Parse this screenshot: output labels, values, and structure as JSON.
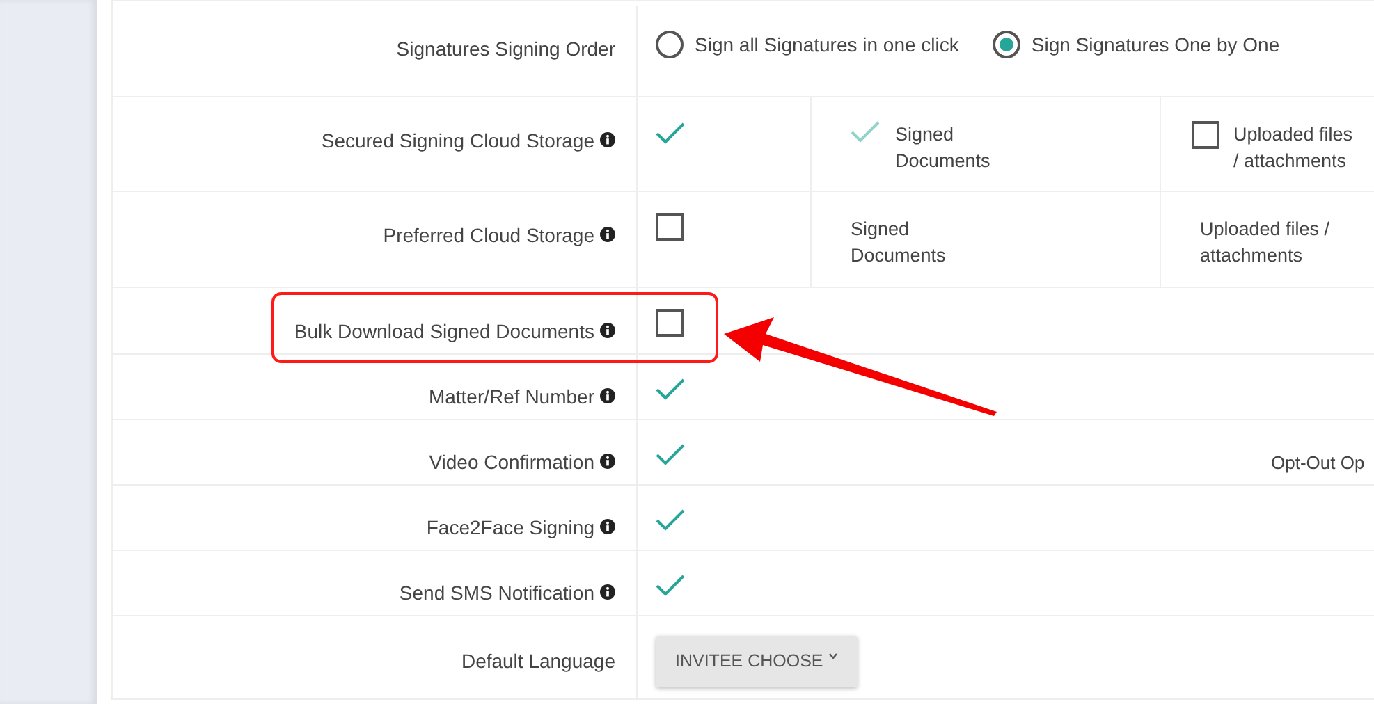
{
  "rows": [
    {
      "label": "Signatures Signing Order",
      "info": false,
      "kind": "radio",
      "options": [
        {
          "label": "Sign all Signatures in one click",
          "selected": false
        },
        {
          "label": "Sign Signatures One by One",
          "selected": true
        }
      ]
    },
    {
      "label": "Secured Signing Cloud Storage",
      "info": true,
      "kind": "check_options",
      "checked": true,
      "options": [
        {
          "label": "Signed Documents",
          "kind": "check",
          "checked": true,
          "disabled": true
        },
        {
          "label": "Uploaded files / attachments",
          "kind": "check",
          "checked": false,
          "disabled": false
        }
      ]
    },
    {
      "label": "Preferred Cloud Storage",
      "info": true,
      "kind": "check_options",
      "checked": false,
      "options": [
        {
          "label": "Signed Documents",
          "kind": "text"
        },
        {
          "label": "Uploaded files / attachments",
          "kind": "text"
        }
      ]
    },
    {
      "label": "Bulk Download Signed Documents",
      "info": true,
      "kind": "check",
      "checked": false,
      "highlighted": true
    },
    {
      "label": "Matter/Ref Number",
      "info": true,
      "kind": "check",
      "checked": true
    },
    {
      "label": "Video Confirmation",
      "info": true,
      "kind": "check",
      "checked": true,
      "note": "Opt-Out Op"
    },
    {
      "label": "Face2Face Signing",
      "info": true,
      "kind": "check",
      "checked": true
    },
    {
      "label": "Send SMS Notification",
      "info": true,
      "kind": "check",
      "checked": true
    },
    {
      "label": "Default Language",
      "info": false,
      "kind": "dropdown",
      "value": "INVITEE CHOOSE"
    }
  ]
}
